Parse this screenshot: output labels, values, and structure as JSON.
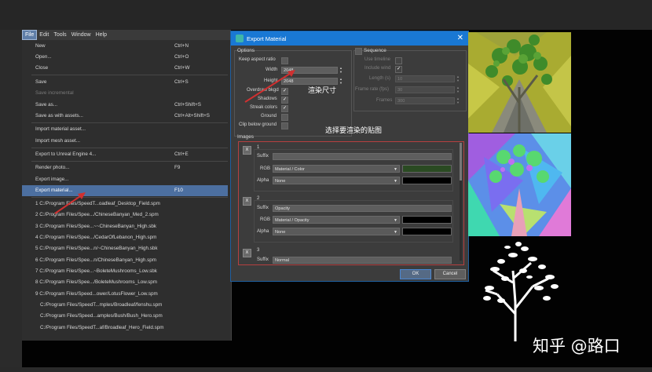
{
  "menubar": {
    "items": [
      "File",
      "Edit",
      "Tools",
      "Window",
      "Help"
    ]
  },
  "file_menu": {
    "items": [
      {
        "label": "New",
        "shortcut": "Ctrl+N"
      },
      {
        "label": "Open...",
        "shortcut": "Ctrl+O"
      },
      {
        "label": "Close",
        "shortcut": "Ctrl+W"
      },
      {
        "label": "Save",
        "shortcut": "Ctrl+S"
      },
      {
        "label": "Save incremental",
        "shortcut": ""
      },
      {
        "label": "Save as...",
        "shortcut": "Ctrl+Shift+S"
      },
      {
        "label": "Save as with assets...",
        "shortcut": "Ctrl+Alt+Shift+S"
      },
      {
        "label": "Import material asset...",
        "shortcut": ""
      },
      {
        "label": "Import mesh asset...",
        "shortcut": ""
      },
      {
        "label": "Export to Unreal Engine 4...",
        "shortcut": "Ctrl+E"
      },
      {
        "label": "Render photo...",
        "shortcut": "F9"
      },
      {
        "label": "Export image...",
        "shortcut": ""
      },
      {
        "label": "Export material...",
        "shortcut": "F10"
      }
    ],
    "recent": [
      "1 C:/Program Files/SpeedT...oadleaf_Desktop_Field.spm",
      "2 C:/Program Files/Spee.../ChineseBanyan_Med_2.spm",
      "3 C:/Program Files/Spee...~~ChineseBanyan_High.sbk",
      "4 C:/Program Files/Spee.../CedarOfLebanon_High.spm",
      "5 C:/Program Files/Spee...n/~ChineseBanyan_High.sbk",
      "6 C:/Program Files/Spee...n/ChineseBanyan_High.spm",
      "7 C:/Program Files/Spee...~BoleteMushrooms_Low.sbk",
      "8 C:/Program Files/Spee.../BoleteMushrooms_Low.spm",
      "9 C:/Program Files/Speed...ower/LotusFlower_Low.spm",
      "C:/Program Files/SpeedT...mples/Broadleaf/fenshu.spm",
      "C:/Program Files/Speed...amples/Bush/Bush_Hero.spm",
      "C:/Program Files/SpeedT...af/Broadleaf_Hero_Field.spm"
    ]
  },
  "dialog": {
    "title": "Export Material",
    "options_title": "Options",
    "keep_aspect": "Keep aspect ratio",
    "width_label": "Width",
    "width_value": "2048",
    "height_label": "Height",
    "height_value": "2048",
    "overdraw": "Overdraw bkgd",
    "shadows": "Shadows",
    "streak": "Streak colors",
    "ground": "Ground",
    "clip_ground": "Clip below ground",
    "sequence_title": "Sequence",
    "use_timeline": "Use timeline",
    "include_wind": "Include wind",
    "length_label": "Length (s)",
    "length_value": "10",
    "framerate_label": "Frame rate (fps)",
    "framerate_value": "30",
    "frames_label": "Frames",
    "frames_value": "300",
    "images_title": "Images",
    "suffix_label": "Suffix",
    "rgb_label": "RGB",
    "alpha_label": "Alpha",
    "x_label": "X",
    "images": [
      {
        "num": "1",
        "suffix": "",
        "rgb": "Material / Color",
        "alpha": "None",
        "rgb_swatch": "#2a4a22",
        "alpha_swatch": "#000000"
      },
      {
        "num": "2",
        "suffix": "Opacity",
        "rgb": "Material / Opacity",
        "alpha": "None",
        "rgb_swatch": "#000000",
        "alpha_swatch": "#000000"
      },
      {
        "num": "3",
        "suffix": "Normal",
        "rgb": "",
        "alpha": ""
      }
    ],
    "ok": "OK",
    "cancel": "Cancel"
  },
  "annotations": {
    "size_note": "渲染尺寸",
    "maps_note": "选择要渲染的贴图"
  },
  "watermark": "知乎 @路口",
  "colors": {
    "title_blue": "#1978d4",
    "highlight": "#4c6fa0",
    "annotation_red": "#d03030"
  }
}
